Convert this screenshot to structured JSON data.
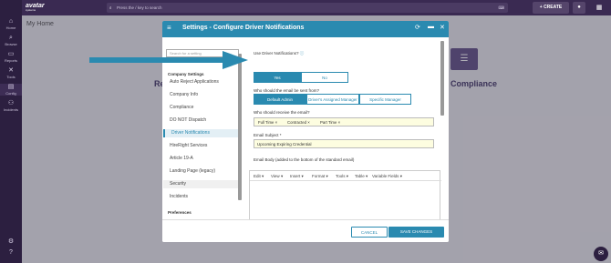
{
  "topbar": {
    "logo": "avatar",
    "logo_sub": "systems",
    "search_placeholder": "Press the / key to search",
    "create_label": "CREATE",
    "search_icon": "search-icon",
    "keyboard_icon": "keyboard-icon",
    "user_icon": "user-icon",
    "grid_icon": "grid-icon"
  },
  "sidebar": {
    "items": [
      {
        "label": "Home",
        "icon": "home-icon"
      },
      {
        "label": "Browse",
        "icon": "search-icon"
      },
      {
        "label": "Reports",
        "icon": "folder-icon"
      },
      {
        "label": "Tools",
        "icon": "tools-icon"
      },
      {
        "label": "Config",
        "icon": "config-icon"
      },
      {
        "label": "Incidents",
        "icon": "incidents-icon"
      }
    ]
  },
  "main": {
    "title": "My Home",
    "bg_left": "Re",
    "bg_right": "Compliance"
  },
  "modal": {
    "title": "Settings - Configure Driver Notifications",
    "left": {
      "search_placeholder": "Search for a setting",
      "section_company": "Company Settings",
      "items": [
        "Auto Reject Applications",
        "Company Info",
        "Compliance",
        "DO NOT Dispatch",
        "Driver Notifications",
        "HireRight Services",
        "Article 19-A",
        "Landing Page (legacy)",
        "Security",
        "Incidents"
      ],
      "section_preferences": "Preferences"
    },
    "right": {
      "use_notifications_label": "Use Driver Notifications?",
      "yes_label": "Yes",
      "no_label": "No",
      "sent_from_label": "Who should the email be sent from?",
      "sender_options": [
        "Default Admin",
        "Driver's Assigned Manager",
        "Specific Manager"
      ],
      "receive_label": "Who should receive the email?",
      "recipient_tags": [
        "Full Time",
        "Contracted",
        "Part Time"
      ],
      "subject_label": "Email Subject *",
      "subject_value": "Upcoming Expiring Credential",
      "body_label": "Email Body (added to the bottom of the standard email)",
      "editor_menus": [
        "Edit",
        "View",
        "Insert",
        "Format",
        "Tools",
        "Table",
        "Variable Fields"
      ]
    },
    "footer": {
      "cancel": "CANCEL",
      "save": "SAVE CHANGES"
    }
  },
  "colors": {
    "accent": "#2a8ab0",
    "sidebar": "#2c1f40",
    "topbar": "#3a2a52",
    "arrow": "#2a8ab0"
  }
}
